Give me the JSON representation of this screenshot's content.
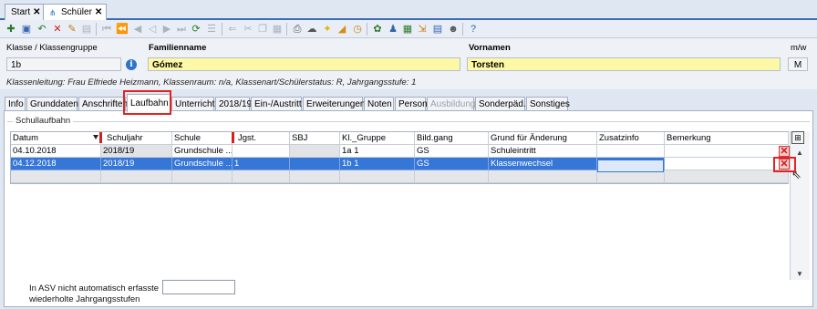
{
  "doc_tabs": [
    {
      "label": "Start",
      "close": "✕"
    },
    {
      "label": "Schüler",
      "close": "✕"
    }
  ],
  "form": {
    "klasse_label": "Klasse / Klassengruppe",
    "klasse_value": "1b",
    "familienname_label": "Familienname",
    "familienname_value": "Gómez",
    "vornamen_label": "Vornamen",
    "vornamen_value": "Torsten",
    "mw_label": "m/w",
    "mw_value": "M",
    "class_info": "Klassenleitung: Frau Elfriede Heizmann, Klassenraum: n/a, Klassenart/Schülerstatus: R, Jahrgangsstufe: 1"
  },
  "section_tabs": [
    {
      "label": "Info"
    },
    {
      "label": "Grunddaten"
    },
    {
      "label": "Anschriften"
    },
    {
      "label": "Laufbahn"
    },
    {
      "label": "Unterricht"
    },
    {
      "label": "2018/19"
    },
    {
      "label": "Ein-/Austritt"
    },
    {
      "label": "Erweiterungen"
    },
    {
      "label": "Noten"
    },
    {
      "label": "Person"
    },
    {
      "label": "Ausbildung"
    },
    {
      "label": "Sonderpäd."
    },
    {
      "label": "Sonstiges"
    }
  ],
  "active_tab": "Laufbahn",
  "group_title": "Schullaufbahn",
  "grid": {
    "columns": [
      "Datum",
      "Schuljahr",
      "Schule",
      "Jgst.",
      "SBJ",
      "Kl._Gruppe",
      "Bild.gang",
      "Grund für Änderung",
      "Zusatzinfo",
      "Bemerkung"
    ],
    "rows": [
      [
        "04.10.2018",
        "2018/19",
        "Grundschule ...",
        "",
        "",
        "1a 1",
        "GS",
        "Schuleintritt",
        "",
        ""
      ],
      [
        "04.12.2018",
        "2018/19",
        "Grundschule ...",
        "1",
        "",
        "1b 1",
        "GS",
        "Klassenwechsel",
        "",
        ""
      ]
    ]
  },
  "icons": {
    "column_chooser": "⊞",
    "delete": "✕",
    "info": "i",
    "scroll_up": "▲",
    "scroll_down": "▼",
    "cursor": "⇖"
  },
  "bottom": {
    "label_line1": "In ASV nicht automatisch erfasste",
    "label_line2": "wiederholte Jahrgangsstufen",
    "value": ""
  },
  "colors": {
    "selection": "#3576d6",
    "highlight_red": "#e32222",
    "name_field_yellow": "#fdf8a6"
  }
}
